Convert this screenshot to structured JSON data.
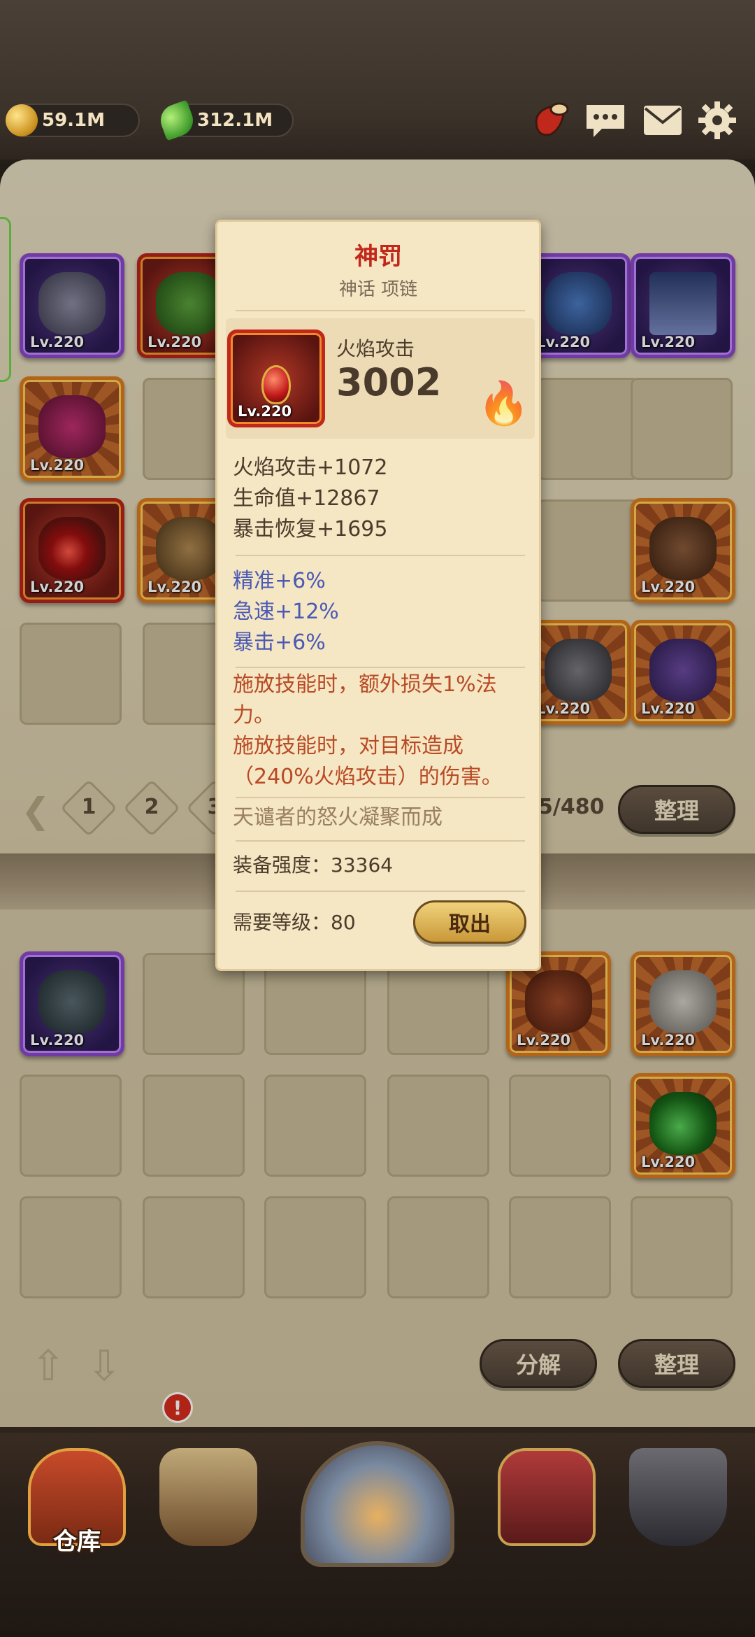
{
  "currency": {
    "coins": "59.1M",
    "gems": "312.1M"
  },
  "icons": {
    "coin": "coin-icon",
    "gem": "gem-icon",
    "bag": "bag-icon",
    "chat": "chat-icon",
    "mail": "mail-icon",
    "settings": "gear-icon"
  },
  "equipment_level_label": "Lv.220",
  "pager": {
    "pages": [
      "1",
      "2",
      "3"
    ],
    "count": "5/480",
    "sort_label": "整理"
  },
  "bottom_actions": {
    "decompose_label": "分解",
    "sort_label": "整理"
  },
  "nav": {
    "warehouse_label": "仓库",
    "badge": "!"
  },
  "tooltip": {
    "name": "神罚",
    "subtitle": "神话 项链",
    "main_stat_name": "火焰攻击",
    "main_stat_value": "3002",
    "item_level": "Lv.220",
    "base_stats": [
      "火焰攻击+1072",
      "生命值+12867",
      "暴击恢复+1695"
    ],
    "bonus_stats": [
      "精准+6%",
      "急速+12%",
      "暴击+6%"
    ],
    "effects": [
      "施放技能时，额外损失1%法力。",
      "施放技能时，对目标造成（240%火焰攻击）的伤害。"
    ],
    "flavor": "天谴者的怒火凝聚而成",
    "power_label": "装备强度：33364",
    "required_level_label": "需要等级：80",
    "take_out_label": "取出"
  },
  "colors": {
    "mythic_red": "#c3271a",
    "bonus_blue": "#4a59b4",
    "effect_orange": "#b84a24",
    "parchment": "#f5e6c4"
  }
}
